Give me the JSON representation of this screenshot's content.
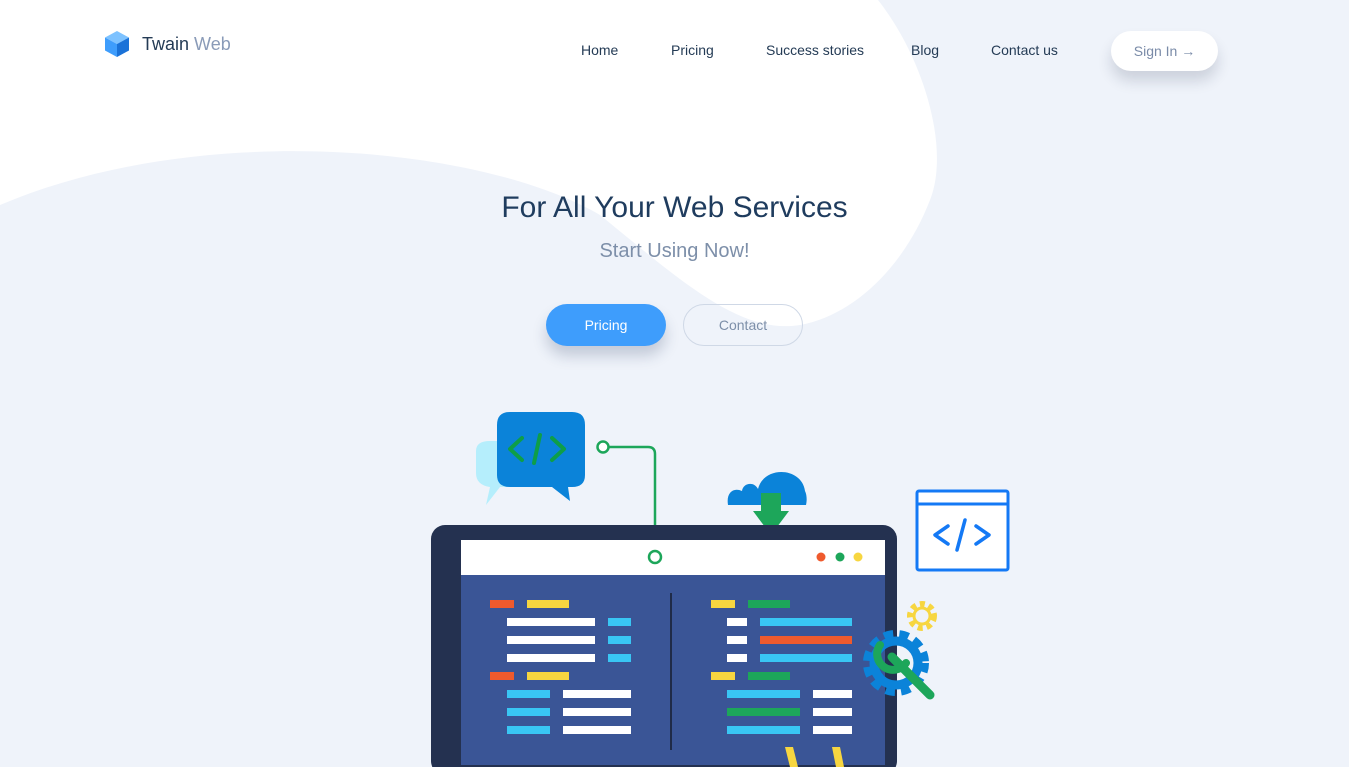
{
  "brand": {
    "name": "Twain",
    "accent": "Web",
    "icon": "cube-logo-icon"
  },
  "nav": {
    "items": [
      {
        "label": "Home"
      },
      {
        "label": "Pricing"
      },
      {
        "label": "Success stories"
      },
      {
        "label": "Blog"
      },
      {
        "label": "Contact us"
      }
    ],
    "signin_label": "Sign In →"
  },
  "hero": {
    "title": "For All Your Web Services",
    "subtitle": "Start Using Now!",
    "primary_button": "Pricing",
    "secondary_button": "Contact"
  },
  "illustration": {
    "icons": [
      "code-chat-bubble-icon",
      "cloud-download-icon",
      "code-window-icon",
      "gear-wrench-icon",
      "laptop-code-editor-icon"
    ]
  },
  "colors": {
    "background": "#eff3fa",
    "primary": "#3e9dfc",
    "heading": "#1f3c5e",
    "muted": "#7d8fa9",
    "laptop_screen": "#3a5596",
    "laptop_frame": "#243150"
  }
}
